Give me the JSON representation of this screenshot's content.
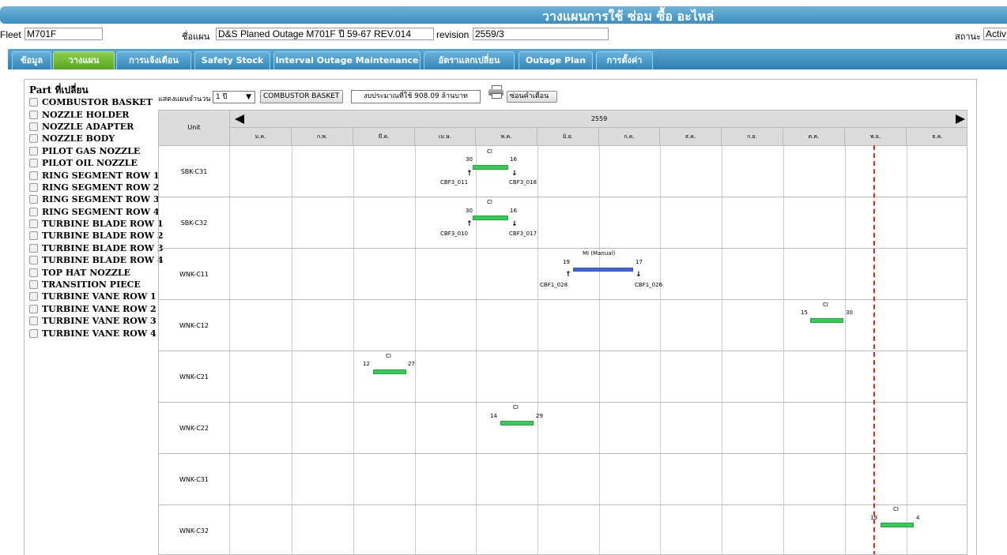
{
  "header": {
    "title": "วางแผนการใช้ ซ่อม ซื้อ อะไหล่"
  },
  "info": {
    "fleet_label": "Fleet",
    "fleet_value": "M701F",
    "plan_label": "ชื่อแผน",
    "plan_value": "D&S Planed Outage M701F ปี 59-67 REV.014",
    "revision_label": "revision",
    "revision_value": "2559/3",
    "status_label": "สถานะ",
    "status_value": "Activ"
  },
  "tabs": [
    {
      "label": "ข้อมูล"
    },
    {
      "label": "วางแผน",
      "active": true
    },
    {
      "label": "การแจ้งเตือน"
    },
    {
      "label": "Safety Stock"
    },
    {
      "label": "Interval Outage Maintenance"
    },
    {
      "label": "อัตราแลกเปลี่ยน"
    },
    {
      "label": "Outage Plan"
    },
    {
      "label": "การตั้งค่า"
    }
  ],
  "sidebar": {
    "heading": "Part ที่เปลี่ยน",
    "parts": [
      "COMBUSTOR BASKET",
      "NOZZLE HOLDER",
      "NOZZLE ADAPTER",
      "NOZZLE BODY",
      "PILOT GAS NOZZLE",
      "PILOT OIL NOZZLE",
      "RING SEGMENT ROW 1",
      "RING SEGMENT ROW 2",
      "RING SEGMENT ROW 3",
      "RING SEGMENT ROW 4",
      "TURBINE BLADE ROW 1",
      "TURBINE BLADE ROW 2",
      "TURBINE BLADE ROW 3",
      "TURBINE BLADE ROW 4",
      "TOP HAT NOZZLE",
      "TRANSITION PIECE",
      "TURBINE VANE ROW 1",
      "TURBINE VANE ROW 2",
      "TURBINE VANE ROW 3",
      "TURBINE VANE ROW 4"
    ]
  },
  "toolbar": {
    "show_label": "แสดงแผนจำนวน",
    "years_value": "1 ปี",
    "selected_part": "COMBUSTOR BASKET",
    "budget_text": "งบประมาณที่ใช้ 908.09 ล้านบาท",
    "print_icon": "printer-icon",
    "alert_button": "ซ่อนคำเตือน"
  },
  "gantt": {
    "unit_header": "Unit",
    "year": "2559",
    "months": [
      "ม.ค.",
      "ก.พ.",
      "มี.ค.",
      "เม.ษ.",
      "พ.ค.",
      "มิ.ย.",
      "ก.ค.",
      "ส.ค.",
      "ก.ย.",
      "ต.ค.",
      "พ.ย.",
      "ธ.ค."
    ],
    "units": [
      "SBK-C31",
      "SBK-C32",
      "WNK-C11",
      "WNK-C12",
      "WNK-C21",
      "WNK-C22",
      "WNK-C31",
      "WNK-C32"
    ],
    "today_marker": "current-date-line",
    "colors": {
      "ci": "#33cc55",
      "mi": "#4466dd",
      "today": "#ee2211"
    },
    "events": [
      {
        "unit": "SBK-C31",
        "type": "CI",
        "start_month": "เม.ษ.",
        "start_day": "30",
        "end_month": "พ.ค.",
        "end_day": "16",
        "out": "CBF3_011",
        "in": "CBF3_018"
      },
      {
        "unit": "SBK-C32",
        "type": "CI",
        "start_month": "เม.ษ.",
        "start_day": "30",
        "end_month": "พ.ค.",
        "end_day": "16",
        "out": "CBF3_010",
        "in": "CBF3_017"
      },
      {
        "unit": "WNK-C11",
        "type": "MI (Manual)",
        "start_month": "มิ.ย.",
        "start_day": "19",
        "end_month": "ก.ค.",
        "end_day": "17",
        "out": "CBF1_028",
        "in": "CBF1_026"
      },
      {
        "unit": "WNK-C12",
        "type": "CI",
        "start_month": "ต.ค.",
        "start_day": "15",
        "end_month": "ต.ค.",
        "end_day": "30"
      },
      {
        "unit": "WNK-C21",
        "type": "CI",
        "start_month": "มี.ค.",
        "start_day": "12",
        "end_month": "มี.ค.",
        "end_day": "27"
      },
      {
        "unit": "WNK-C22",
        "type": "CI",
        "start_month": "พ.ค.",
        "start_day": "14",
        "end_month": "พ.ค.",
        "end_day": "29"
      },
      {
        "unit": "WNK-C32",
        "type": "CI",
        "start_month": "พ.ย.",
        "start_day": "19",
        "end_month": "ธ.ค.",
        "end_day": "4"
      }
    ]
  }
}
